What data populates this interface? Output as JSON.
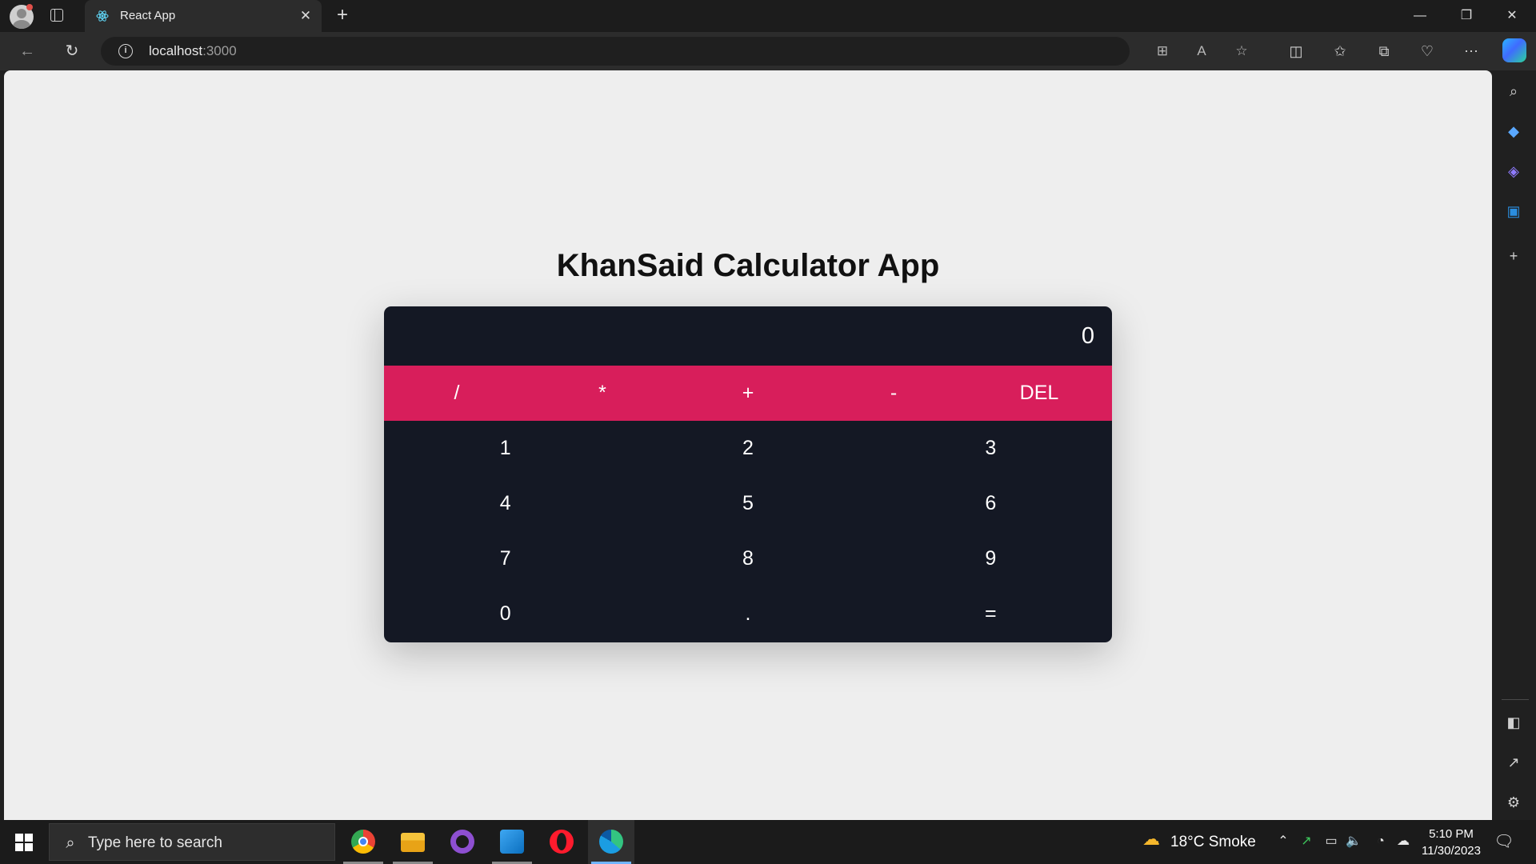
{
  "browser": {
    "tab_title": "React App",
    "tab_close_glyph": "✕",
    "new_tab_glyph": "+",
    "url_host": "localhost",
    "url_port": ":3000",
    "window_controls": {
      "minimize": "—",
      "restore": "❐",
      "close": "✕"
    },
    "icons": [
      "back-icon",
      "refresh-icon",
      "site-info-icon",
      "app-available-icon",
      "read-aloud-icon",
      "favorite-star-icon",
      "split-screen-icon",
      "favorites-icon",
      "collections-icon",
      "browser-essentials-icon",
      "more-menu-icon",
      "copilot-icon"
    ]
  },
  "app": {
    "title": "KhanSaid Calculator App",
    "display_value": "0",
    "operators": [
      "/",
      "*",
      "+",
      "-",
      "DEL"
    ],
    "digit_rows": [
      [
        "1",
        "2",
        "3"
      ],
      [
        "4",
        "5",
        "6"
      ],
      [
        "7",
        "8",
        "9"
      ],
      [
        "0",
        ".",
        "="
      ]
    ],
    "colors": {
      "page_bg": "#eeeeee",
      "calculator_bg": "#141824",
      "operator_bar": "#d81e5b",
      "key_text": "#ffffff"
    }
  },
  "sidebar": {
    "icons": [
      "search-icon",
      "shopping-icon",
      "copilot-apps-icon",
      "outlook-icon",
      "add-icon",
      "hide-sidebar-icon",
      "external-link-icon",
      "settings-icon"
    ]
  },
  "taskbar": {
    "search_placeholder": "Type here to search",
    "apps": [
      "chrome",
      "file-explorer",
      "github-desktop",
      "vscode",
      "opera",
      "edge"
    ],
    "weather": "18°C  Smoke",
    "time": "5:10 PM",
    "date": "11/30/2023"
  }
}
